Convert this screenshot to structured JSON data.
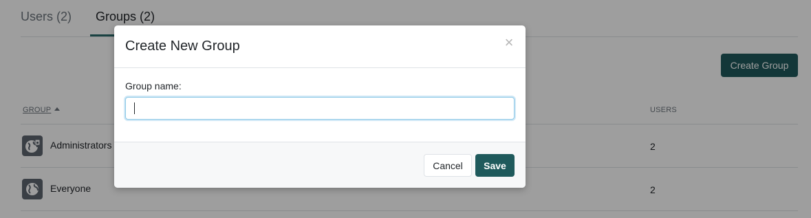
{
  "tabs": [
    {
      "label": "Users (2)",
      "active": false
    },
    {
      "label": "Groups (2)",
      "active": true
    }
  ],
  "toolbar": {
    "create_group_label": "Create Group"
  },
  "table": {
    "columns": {
      "group": "GROUP",
      "users": "USERS"
    },
    "sort": {
      "column": "group",
      "direction": "ascending"
    },
    "rows": [
      {
        "name": "Administrators",
        "users": "2",
        "icon": "admin-group-icon"
      },
      {
        "name": "Everyone",
        "users": "2",
        "icon": "globe-icon"
      }
    ]
  },
  "modal": {
    "title": "Create New Group",
    "close_glyph": "×",
    "field_label": "Group name:",
    "input_value": "",
    "cancel_label": "Cancel",
    "save_label": "Save"
  },
  "colors": {
    "primary": "#1f5a5c",
    "active_tab_underline": "#2b6b6b",
    "focus_ring": "#8cc8e6"
  }
}
